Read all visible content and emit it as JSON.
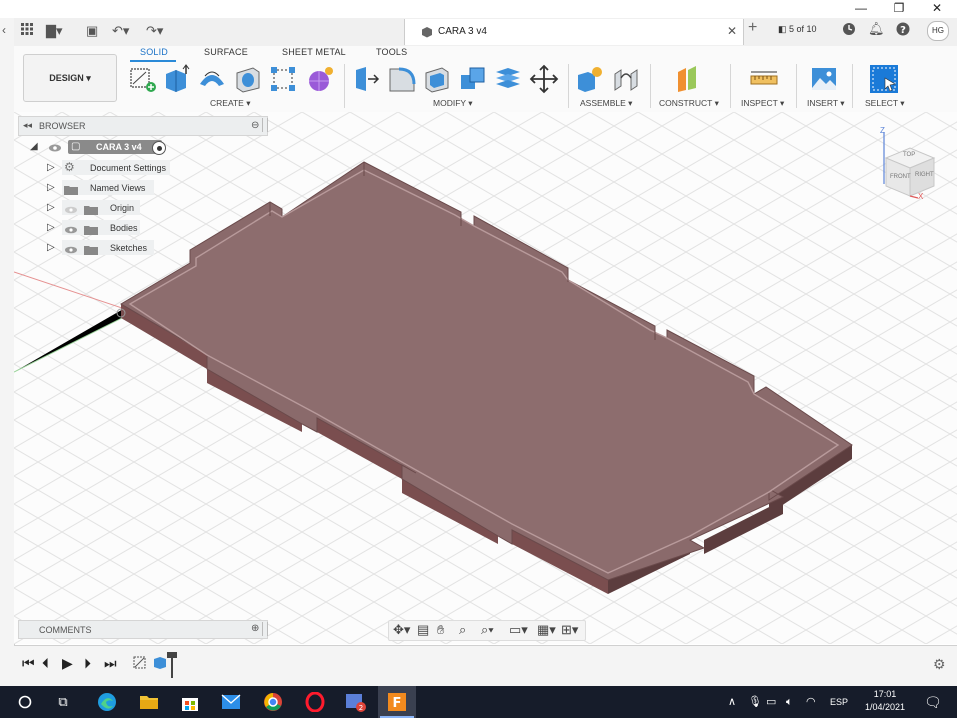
{
  "window": {
    "minimize": "—",
    "restore": "❐",
    "close": "✕"
  },
  "document": {
    "title": "CARA 3 v4",
    "close": "✕",
    "new_tab": "+",
    "jobs": "5 of 10",
    "user_initials": "HG"
  },
  "ribbon": {
    "tabs": [
      "SOLID",
      "SURFACE",
      "SHEET METAL",
      "TOOLS"
    ],
    "active_tab": "SOLID",
    "design": "DESIGN ▾",
    "groups": [
      "CREATE ▾",
      "MODIFY ▾",
      "ASSEMBLE ▾",
      "CONSTRUCT ▾",
      "INSPECT ▾",
      "INSERT ▾",
      "SELECT ▾"
    ]
  },
  "browser": {
    "title": "BROWSER",
    "root": "CARA 3 v4",
    "items": [
      "Document Settings",
      "Named Views",
      "Origin",
      "Bodies",
      "Sketches"
    ]
  },
  "comments": {
    "title": "COMMENTS"
  },
  "viewcube": {
    "top": "TOP",
    "front": "FRONT",
    "right": "RIGHT",
    "z": "Z",
    "x": "X"
  },
  "taskbar": {
    "lang": "ESP",
    "time": "17:01",
    "date": "1/04/2021"
  },
  "colors": {
    "accent": "#1b72c7",
    "body": "#8a6a6b",
    "taskbar": "#161c2a"
  }
}
